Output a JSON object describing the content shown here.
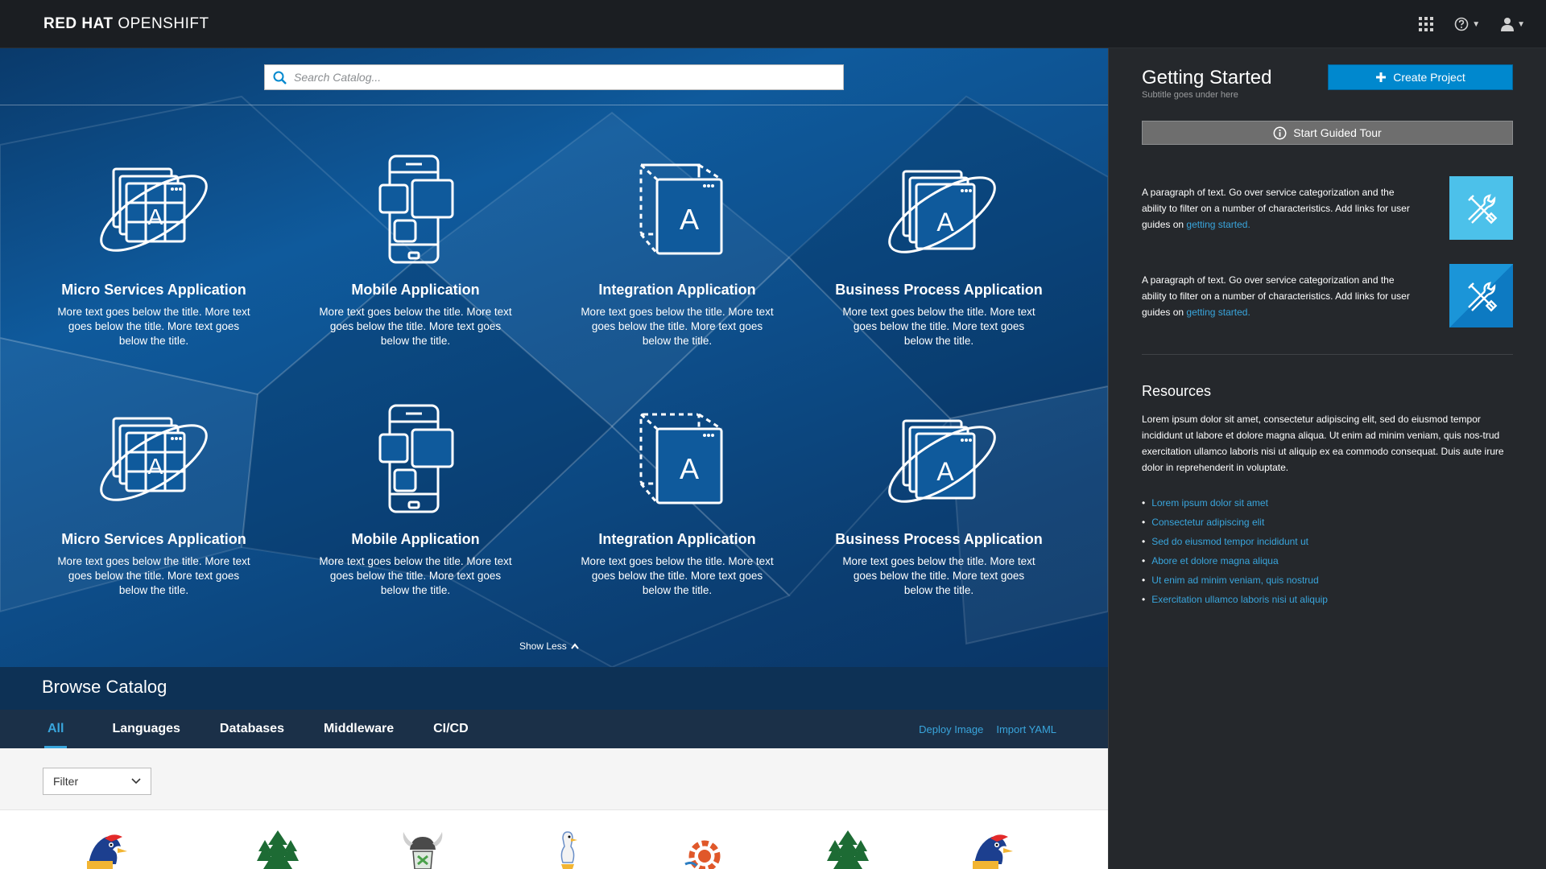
{
  "brand": {
    "bold": "RED HAT",
    "thin": "OPENSHIFT"
  },
  "search": {
    "placeholder": "Search Catalog..."
  },
  "tiles": [
    {
      "title": "Micro Services Application",
      "desc": "More text goes below the title. More text goes below the title. More text goes below the title.",
      "icon": "microservices-icon"
    },
    {
      "title": "Mobile Application",
      "desc": "More text goes below the title. More text goes below the title. More text goes below the title.",
      "icon": "mobile-icon"
    },
    {
      "title": "Integration Application",
      "desc": "More text goes below the title. More text goes below the title. More text goes below the title.",
      "icon": "integration-icon"
    },
    {
      "title": "Business Process Application",
      "desc": "More text goes below the title. More text goes below the title. More text goes below the title.",
      "icon": "business-process-icon"
    },
    {
      "title": "Micro Services Application",
      "desc": "More text goes below the title. More text goes below the title. More text goes below the title.",
      "icon": "microservices-icon"
    },
    {
      "title": "Mobile Application",
      "desc": "More text goes below the title. More text goes below the title. More text goes below the title.",
      "icon": "mobile-icon"
    },
    {
      "title": "Integration Application",
      "desc": "More text goes below the title. More text goes below the title. More text goes below the title.",
      "icon": "integration-icon"
    },
    {
      "title": "Business Process Application",
      "desc": "More text goes below the title. More text goes below the title. More text goes below the title.",
      "icon": "business-process-icon"
    }
  ],
  "show_less": "Show Less",
  "browse": {
    "title": "Browse Catalog"
  },
  "tabs": [
    {
      "label": "All",
      "active": true
    },
    {
      "label": "Languages"
    },
    {
      "label": "Databases"
    },
    {
      "label": "Middleware"
    },
    {
      "label": "CI/CD"
    }
  ],
  "tab_links": {
    "deploy": "Deploy Image",
    "import": "Import YAML"
  },
  "filter": {
    "label": "Filter"
  },
  "side": {
    "title": "Getting Started",
    "subtitle": "Subtitle goes under here",
    "create": "Create Project",
    "tour": "Start Guided Tour",
    "items": [
      {
        "text": "A paragraph of text. Go over service categorization and the ability to filter on a number of characteristics. Add links for user guides on ",
        "link": "getting started."
      },
      {
        "text": "A paragraph of text. Go over service categorization and the ability to filter on a number of characteristics. Add links for user guides on ",
        "link": "getting started."
      }
    ],
    "resources_title": "Resources",
    "resources_text": "Lorem ipsum dolor sit amet, consectetur adipiscing elit, sed do eiusmod tempor incididunt ut labore et dolore magna aliqua. Ut enim ad minim veniam, quis nos-trud exercitation ullamco laboris nisi ut aliquip ex ea commodo consequat. Duis aute irure dolor in reprehenderit in voluptate.",
    "links": [
      "Lorem ipsum dolor sit amet",
      "Consectetur adipiscing elit",
      "Sed do eiusmod tempor incididunt ut",
      "Abore et dolore magna aliqua",
      "Ut enim ad minim veniam, quis nostrud",
      "Exercitation ullamco laboris nisi ut aliquip"
    ]
  },
  "colors": {
    "accent": "#39a5dc",
    "primary_button": "#0088ce",
    "nav_bg": "#1b1e22",
    "panel_bg": "#25282c"
  }
}
